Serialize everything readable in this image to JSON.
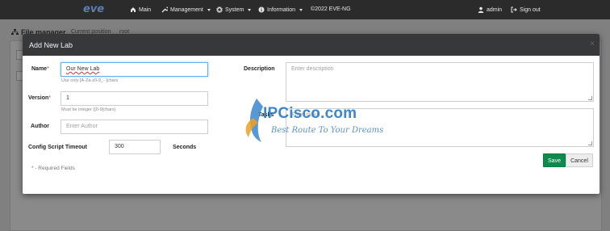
{
  "navbar": {
    "logo_text": "eve",
    "items": [
      {
        "label": "Main",
        "icon": "home-icon"
      },
      {
        "label": "Management",
        "icon": "wrench-icon"
      },
      {
        "label": "System",
        "icon": "gear-icon"
      },
      {
        "label": "Information",
        "icon": "info-icon"
      },
      {
        "label": "©2022 EVE-NG"
      }
    ],
    "user": {
      "label": "admin",
      "icon": "user-icon"
    },
    "signout": {
      "label": "Sign out",
      "icon": "signout-icon"
    }
  },
  "background": {
    "title": "File manager",
    "crumb": "Current position",
    "crumb_path": "root"
  },
  "modal": {
    "title": "Add New Lab",
    "close": "×",
    "name": {
      "label": "Name",
      "required_mark": "*",
      "value": "Our New Lab",
      "help": "Use only [A-Za-z0-9_- ]chars"
    },
    "version": {
      "label": "Version",
      "required_mark": "*",
      "value": "1",
      "help": "Must be integer ([0-9]chars)"
    },
    "author": {
      "label": "Author",
      "placeholder": "Enter Author"
    },
    "config_timeout": {
      "label": "Config Script Timeout",
      "value": "300",
      "unit": "Seconds"
    },
    "description": {
      "label": "Description",
      "placeholder": "Enter description"
    },
    "tasks": {
      "label": "Tasks",
      "placeholder": "Enter tasks"
    },
    "required_note": "* - Required Fields",
    "save_label": "Save",
    "cancel_label": "Cancel"
  },
  "watermark": {
    "brand": "IPCisco.com",
    "slogan": "Best Route To Your Dreams"
  },
  "colors": {
    "navbar": "#2b2b2b",
    "modal_header": "#36383a",
    "save": "#0e8a4d",
    "required": "#c9302c",
    "watermark": "#2e7cc6"
  }
}
